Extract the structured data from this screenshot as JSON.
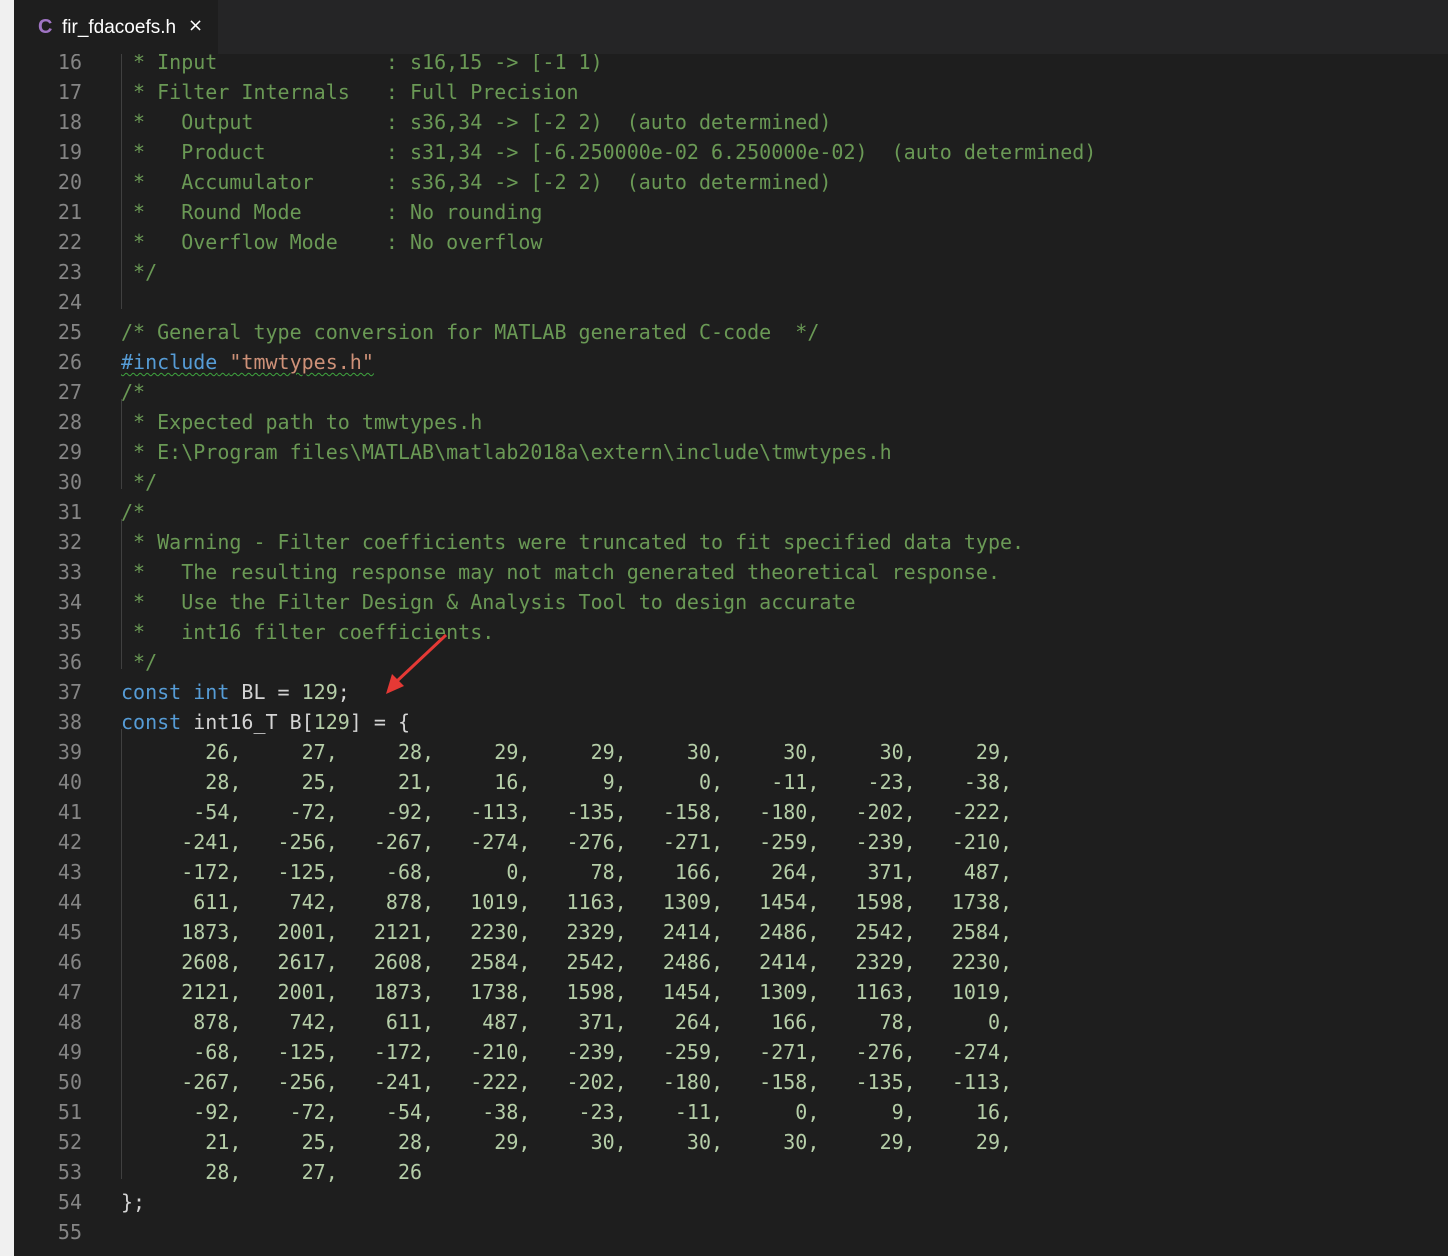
{
  "tab": {
    "icon": "C",
    "title": "fir_fdacoefs.h",
    "close": "×"
  },
  "editor": {
    "lines": [
      {
        "n": "16",
        "t": " * Input              : s16,15 -> [-1 1)",
        "cls": "c"
      },
      {
        "n": "17",
        "t": " * Filter Internals   : Full Precision",
        "cls": "c"
      },
      {
        "n": "18",
        "t": " *   Output           : s36,34 -> [-2 2)  (auto determined)",
        "cls": "c"
      },
      {
        "n": "19",
        "t": " *   Product          : s31,34 -> [-6.250000e-02 6.250000e-02)  (auto determined)",
        "cls": "c"
      },
      {
        "n": "20",
        "t": " *   Accumulator      : s36,34 -> [-2 2)  (auto determined)",
        "cls": "c"
      },
      {
        "n": "21",
        "t": " *   Round Mode       : No rounding",
        "cls": "c"
      },
      {
        "n": "22",
        "t": " *   Overflow Mode    : No overflow",
        "cls": "c"
      },
      {
        "n": "23",
        "t": " */",
        "cls": "c"
      },
      {
        "n": "24",
        "t": "",
        "cls": "c"
      },
      {
        "n": "25",
        "t": "/* General type conversion for MATLAB generated C-code  */",
        "cls": "c"
      },
      {
        "n": "26",
        "t": "",
        "cls": "include"
      },
      {
        "n": "27",
        "t": "/*",
        "cls": "c"
      },
      {
        "n": "28",
        "t": " * Expected path to tmwtypes.h",
        "cls": "c"
      },
      {
        "n": "29",
        "t": " * E:\\Program files\\MATLAB\\matlab2018a\\extern\\include\\tmwtypes.h",
        "cls": "c"
      },
      {
        "n": "30",
        "t": " */",
        "cls": "c"
      },
      {
        "n": "31",
        "t": "/*",
        "cls": "c"
      },
      {
        "n": "32",
        "t": " * Warning - Filter coefficients were truncated to fit specified data type.",
        "cls": "c"
      },
      {
        "n": "33",
        "t": " *   The resulting response may not match generated theoretical response.",
        "cls": "c"
      },
      {
        "n": "34",
        "t": " *   Use the Filter Design & Analysis Tool to design accurate",
        "cls": "c"
      },
      {
        "n": "35",
        "t": " *   int16 filter coefficients.",
        "cls": "c"
      },
      {
        "n": "36",
        "t": " */",
        "cls": "c"
      },
      {
        "n": "37",
        "t": "",
        "cls": "bl"
      },
      {
        "n": "38",
        "t": "",
        "cls": "decl"
      },
      {
        "n": "39",
        "t": "       26,     27,     28,     29,     29,     30,     30,     30,     29,",
        "cls": "n"
      },
      {
        "n": "40",
        "t": "       28,     25,     21,     16,      9,      0,    -11,    -23,    -38,",
        "cls": "n"
      },
      {
        "n": "41",
        "t": "      -54,    -72,    -92,   -113,   -135,   -158,   -180,   -202,   -222,",
        "cls": "n"
      },
      {
        "n": "42",
        "t": "     -241,   -256,   -267,   -274,   -276,   -271,   -259,   -239,   -210,",
        "cls": "n"
      },
      {
        "n": "43",
        "t": "     -172,   -125,    -68,      0,     78,    166,    264,    371,    487,",
        "cls": "n"
      },
      {
        "n": "44",
        "t": "      611,    742,    878,   1019,   1163,   1309,   1454,   1598,   1738,",
        "cls": "n"
      },
      {
        "n": "45",
        "t": "     1873,   2001,   2121,   2230,   2329,   2414,   2486,   2542,   2584,",
        "cls": "n"
      },
      {
        "n": "46",
        "t": "     2608,   2617,   2608,   2584,   2542,   2486,   2414,   2329,   2230,",
        "cls": "n"
      },
      {
        "n": "47",
        "t": "     2121,   2001,   1873,   1738,   1598,   1454,   1309,   1163,   1019,",
        "cls": "n"
      },
      {
        "n": "48",
        "t": "      878,    742,    611,    487,    371,    264,    166,     78,      0,",
        "cls": "n"
      },
      {
        "n": "49",
        "t": "      -68,   -125,   -172,   -210,   -239,   -259,   -271,   -276,   -274,",
        "cls": "n"
      },
      {
        "n": "50",
        "t": "     -267,   -256,   -241,   -222,   -202,   -180,   -158,   -135,   -113,",
        "cls": "n"
      },
      {
        "n": "51",
        "t": "      -92,    -72,    -54,    -38,    -23,    -11,      0,      9,     16,",
        "cls": "n"
      },
      {
        "n": "52",
        "t": "       21,     25,     28,     29,     30,     30,     30,     29,     29,",
        "cls": "n"
      },
      {
        "n": "53",
        "t": "       28,     27,     26",
        "cls": "n"
      },
      {
        "n": "54",
        "t": "};",
        "cls": "p"
      },
      {
        "n": "55",
        "t": "",
        "cls": "p"
      }
    ]
  },
  "include_line": {
    "directive": "#include",
    "space": " ",
    "file": "\"tmwtypes.h\""
  },
  "bl_line": {
    "kw1": "const",
    "sp1": " ",
    "kw2": "int",
    "rest": " BL = ",
    "num": "129",
    "end": ";"
  },
  "decl_line": {
    "kw": "const",
    "rest": " int16_T B[",
    "num": "129",
    "end": "] = {"
  },
  "annotation": {
    "color": "#e53935"
  }
}
